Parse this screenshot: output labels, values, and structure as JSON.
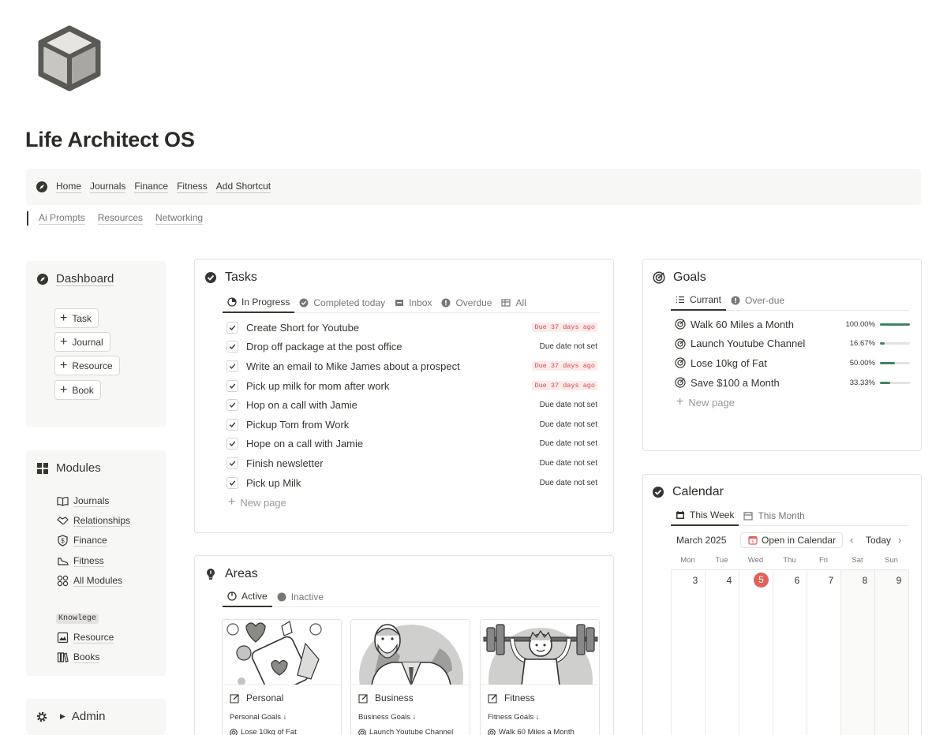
{
  "page": {
    "title": "Life Architect OS",
    "icon": "cube-icon"
  },
  "nav": {
    "links": [
      "Home",
      "Journals",
      "Finance",
      "Fitness",
      "Add Shortcut"
    ],
    "sub_links": [
      "Ai Prompts",
      "Resources",
      "Networking"
    ]
  },
  "dashboard": {
    "title": "Dashboard",
    "buttons": [
      "Task",
      "Journal",
      "Resource",
      "Book"
    ]
  },
  "modules": {
    "title": "Modules",
    "items": [
      "Journals",
      "Relationships",
      "Finance",
      "Fitness",
      "All Modules"
    ],
    "knowledge_tag": "Knowlege",
    "knowledge_items": [
      "Resource",
      "Books"
    ]
  },
  "admin": {
    "title": "Admin"
  },
  "tasks": {
    "title": "Tasks",
    "tabs": [
      "In Progress",
      "Completed today",
      "Inbox",
      "Overdue",
      "All"
    ],
    "rows": [
      {
        "name": "Create Short for Youtube",
        "due": "Due 37 days ago",
        "late": true
      },
      {
        "name": "Drop off package at the post office",
        "due": "Due date not set",
        "late": false
      },
      {
        "name": "Write an email to Mike James about a prospect",
        "due": "Due 37 days ago",
        "late": true
      },
      {
        "name": "Pick up milk for mom after work",
        "due": "Due 37 days ago",
        "late": true
      },
      {
        "name": "Hop on a call with Jamie",
        "due": "Due date not set",
        "late": false
      },
      {
        "name": "Pickup Tom from Work",
        "due": "Due date not set",
        "late": false
      },
      {
        "name": "Hope on a call with Jamie",
        "due": "Due date not set",
        "late": false
      },
      {
        "name": "Finish newsletter",
        "due": "Due date not set",
        "late": false
      },
      {
        "name": "Pick up Milk",
        "due": "Due date not set",
        "late": false
      }
    ],
    "new_page": "New page"
  },
  "goals": {
    "title": "Goals",
    "tabs": [
      "Currant",
      "Over-due"
    ],
    "rows": [
      {
        "name": "Walk 60 Miles a Month",
        "pct": "100.00%",
        "value": 1.0
      },
      {
        "name": "Launch Youtube Channel",
        "pct": "16.67%",
        "value": 0.1667
      },
      {
        "name": "Lose 10kg of Fat",
        "pct": "50.00%",
        "value": 0.5
      },
      {
        "name": "Save $100 a Month",
        "pct": "33.33%",
        "value": 0.3333
      }
    ],
    "new_page": "New page"
  },
  "calendar": {
    "title": "Calendar",
    "tabs": [
      "This Week",
      "This Month"
    ],
    "month": "March 2025",
    "open_btn": "Open in Calendar",
    "today_btn": "Today",
    "weekdays": [
      "Mon",
      "Tue",
      "Wed",
      "Thu",
      "Fri",
      "Sat",
      "Sun"
    ],
    "days": [
      "3",
      "4",
      "5",
      "6",
      "7",
      "8",
      "9"
    ],
    "today_index": 2,
    "accent": "#e16259"
  },
  "areas": {
    "title": "Areas",
    "tabs": [
      "Active",
      "Inactive"
    ],
    "cards": [
      {
        "title": "Personal",
        "sub": "Personal Goals ↓",
        "goal": "Lose 10kg of Fat"
      },
      {
        "title": "Business",
        "sub": "Business Goals ↓",
        "goal": "Launch Youtube Channel"
      },
      {
        "title": "Fitness",
        "sub": "Fitness Goals ↓",
        "goal": "Walk 60 Miles a Month"
      }
    ]
  },
  "colors": {
    "progress": "#448361",
    "late_text": "#d44c47",
    "late_bg": "#fdebec",
    "panel_bg": "#f7f7f5"
  }
}
